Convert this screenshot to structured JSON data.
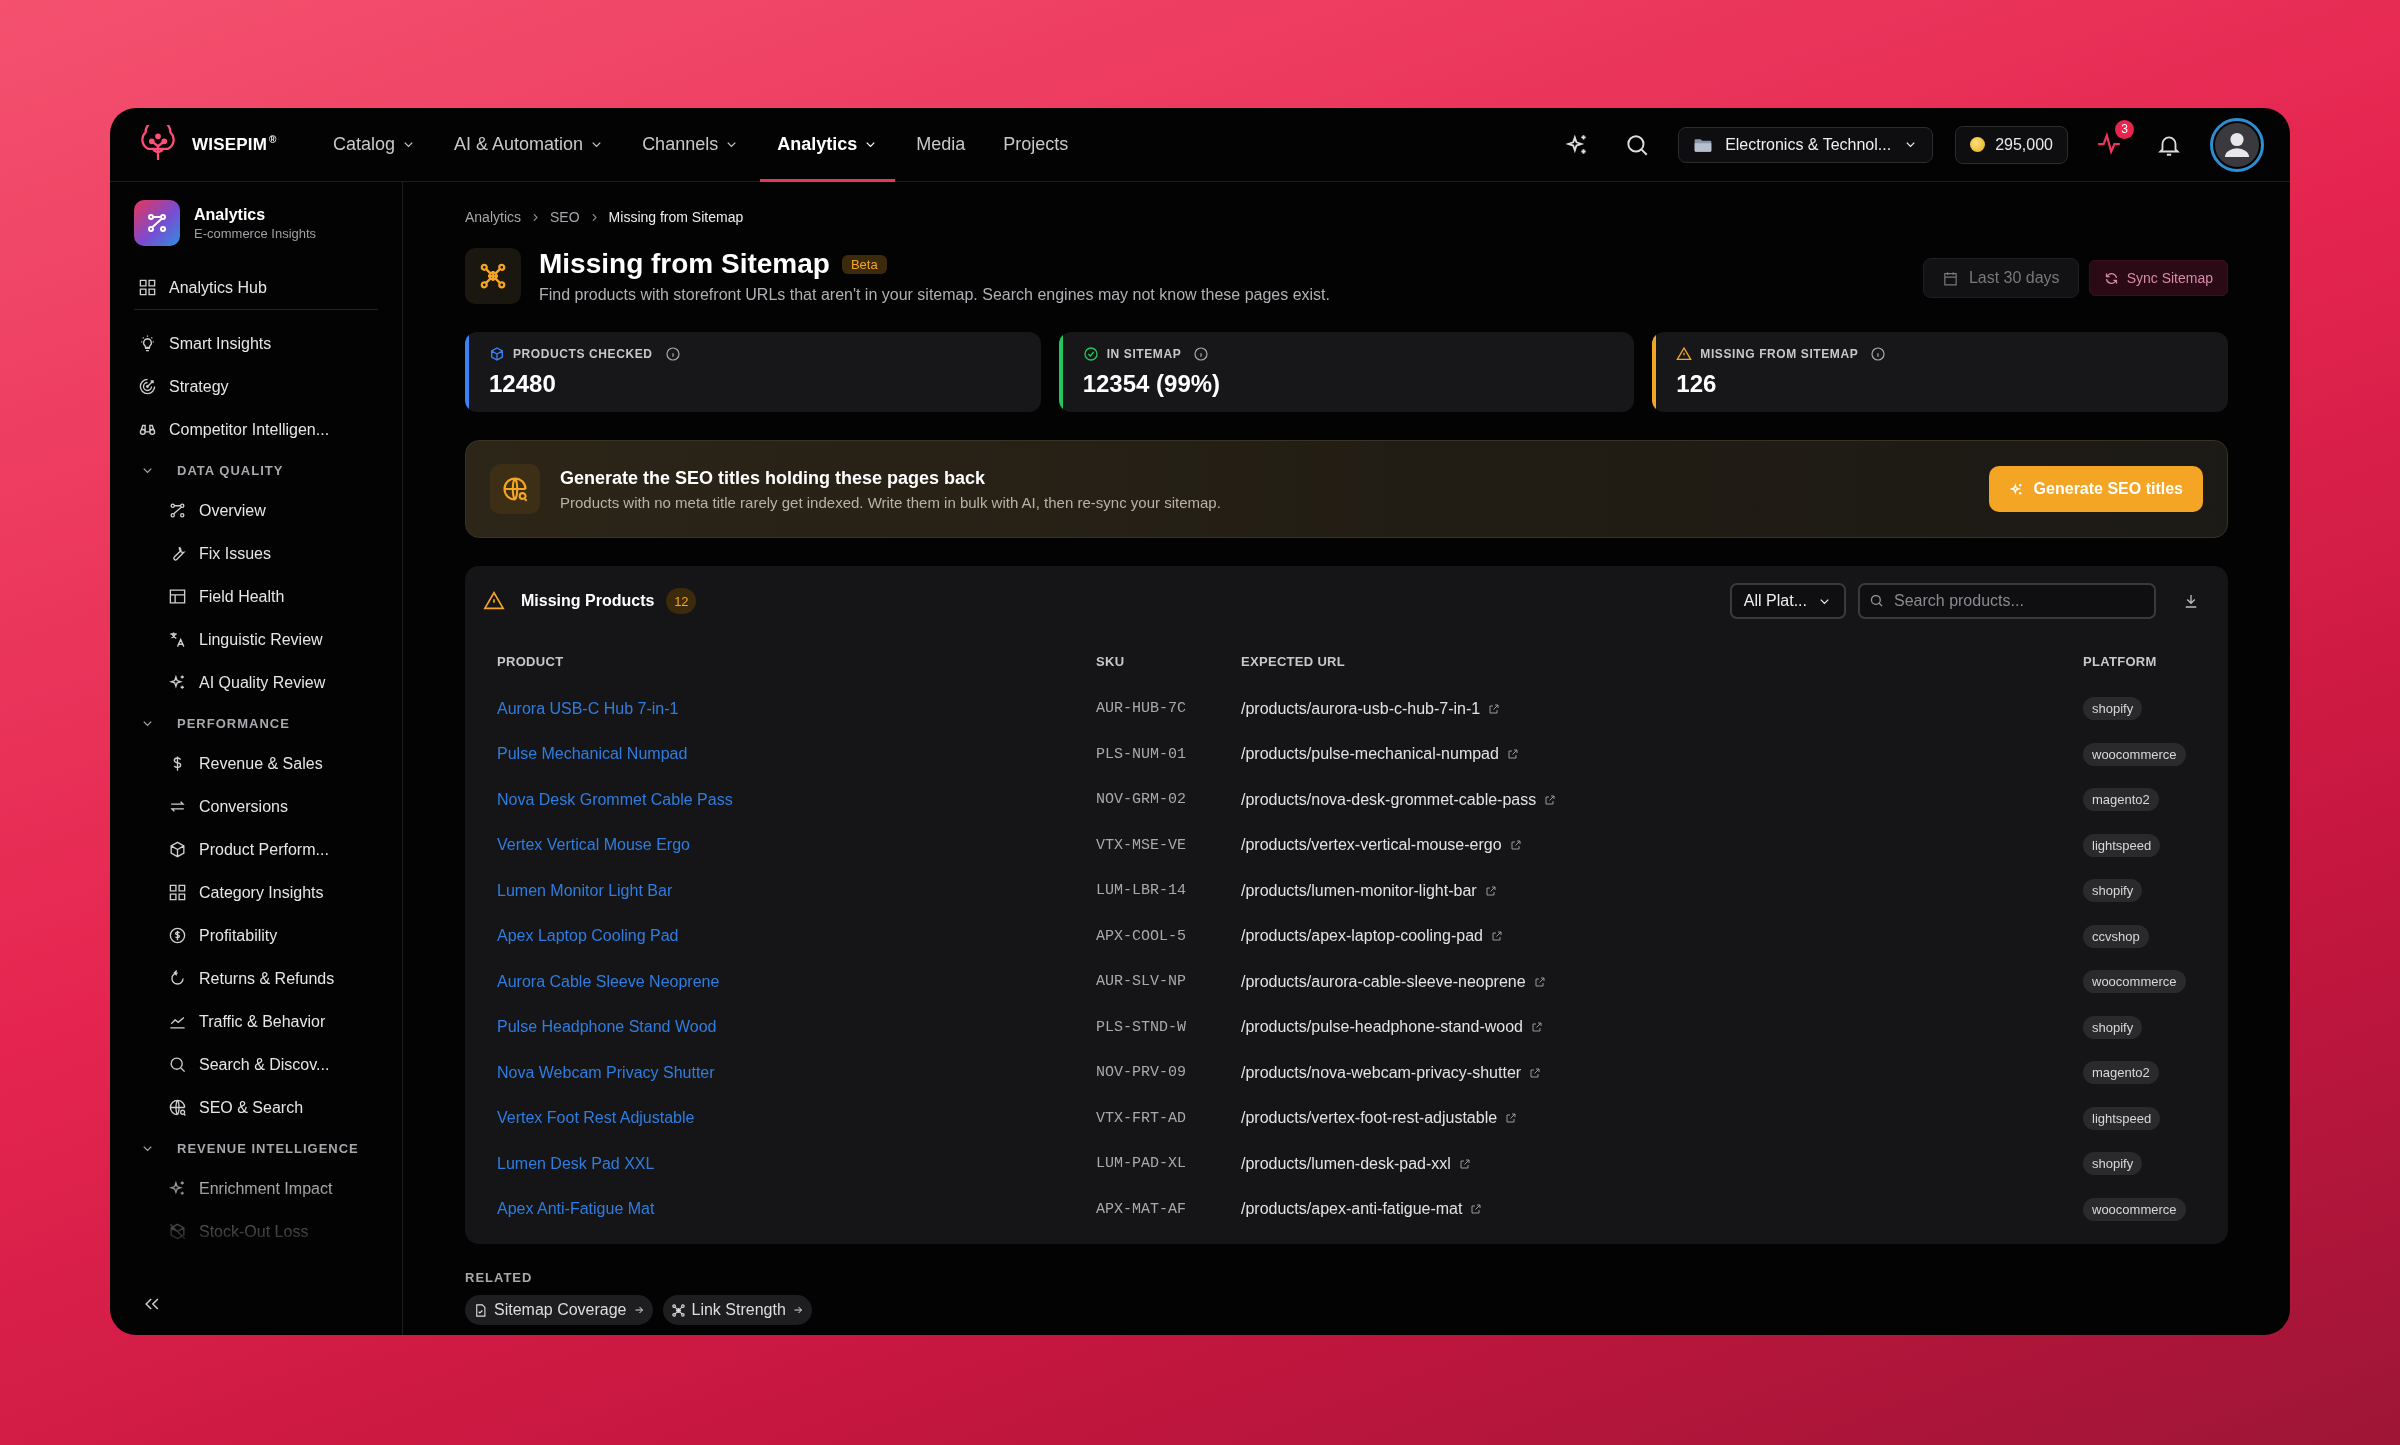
{
  "brand": {
    "name": "WISEPIM",
    "mark": "®"
  },
  "nav": [
    {
      "label": "Catalog",
      "dropdown": true,
      "selected": false
    },
    {
      "label": "AI & Automation",
      "dropdown": true,
      "selected": false
    },
    {
      "label": "Channels",
      "dropdown": true,
      "selected": false
    },
    {
      "label": "Analytics",
      "dropdown": true,
      "selected": true
    },
    {
      "label": "Media",
      "dropdown": false,
      "selected": false
    },
    {
      "label": "Projects",
      "dropdown": false,
      "selected": false
    }
  ],
  "workspace": {
    "label": "Electronics & Technol..."
  },
  "credits": "295,000",
  "alerts_badge": "3",
  "sidebar": {
    "title": "Analytics",
    "subtitle": "E-commerce Insights",
    "pinned": [
      {
        "label": "Analytics Hub"
      }
    ],
    "items": [
      {
        "kind": "link",
        "label": "Smart Insights"
      },
      {
        "kind": "link",
        "label": "Strategy"
      },
      {
        "kind": "link",
        "label": "Competitor Intelligen..."
      },
      {
        "kind": "section",
        "label": "DATA QUALITY",
        "expanded": true,
        "children": [
          {
            "label": "Overview"
          },
          {
            "label": "Fix Issues"
          },
          {
            "label": "Field Health"
          },
          {
            "label": "Linguistic Review"
          },
          {
            "label": "AI Quality Review"
          }
        ]
      },
      {
        "kind": "section",
        "label": "PERFORMANCE",
        "expanded": true,
        "children": [
          {
            "label": "Revenue & Sales"
          },
          {
            "label": "Conversions"
          },
          {
            "label": "Product Perform..."
          },
          {
            "label": "Category Insights"
          },
          {
            "label": "Profitability"
          },
          {
            "label": "Returns & Refunds"
          },
          {
            "label": "Traffic & Behavior"
          },
          {
            "label": "Search & Discov..."
          },
          {
            "label": "SEO & Search"
          }
        ]
      },
      {
        "kind": "section",
        "label": "REVENUE INTELLIGENCE",
        "expanded": true,
        "children": [
          {
            "label": "Enrichment Impact"
          },
          {
            "label": "Stock-Out Loss"
          }
        ]
      }
    ]
  },
  "breadcrumb": [
    "Analytics",
    "SEO",
    "Missing from Sitemap"
  ],
  "page": {
    "title": "Missing from Sitemap",
    "badge": "Beta",
    "subtitle": "Find products with storefront URLs that aren't in your sitemap. Search engines may not know these pages exist."
  },
  "actions": {
    "date_range": "Last 30 days",
    "sync": "Sync Sitemap"
  },
  "stats": [
    {
      "label": "PRODUCTS CHECKED",
      "value": "12480",
      "color": "#3b82f6"
    },
    {
      "label": "IN SITEMAP",
      "value": "12354 (99%)",
      "color": "#22c55e"
    },
    {
      "label": "MISSING FROM SITEMAP",
      "value": "126",
      "color": "#f5a524"
    }
  ],
  "banner": {
    "title": "Generate the SEO titles holding these pages back",
    "text": "Products with no meta title rarely get indexed. Write them in bulk with AI, then re-sync your sitemap.",
    "button": "Generate SEO titles"
  },
  "table": {
    "title": "Missing Products",
    "count": "12",
    "filter": "All Plat...",
    "search_placeholder": "Search products...",
    "columns": [
      "PRODUCT",
      "SKU",
      "EXPECTED URL",
      "PLATFORM"
    ],
    "rows": [
      {
        "product": "Aurora USB-C Hub 7-in-1",
        "sku": "AUR-HUB-7C",
        "url": "/products/aurora-usb-c-hub-7-in-1",
        "platform": "shopify"
      },
      {
        "product": "Pulse Mechanical Numpad",
        "sku": "PLS-NUM-01",
        "url": "/products/pulse-mechanical-numpad",
        "platform": "woocommerce"
      },
      {
        "product": "Nova Desk Grommet Cable Pass",
        "sku": "NOV-GRM-02",
        "url": "/products/nova-desk-grommet-cable-pass",
        "platform": "magento2"
      },
      {
        "product": "Vertex Vertical Mouse Ergo",
        "sku": "VTX-MSE-VE",
        "url": "/products/vertex-vertical-mouse-ergo",
        "platform": "lightspeed"
      },
      {
        "product": "Lumen Monitor Light Bar",
        "sku": "LUM-LBR-14",
        "url": "/products/lumen-monitor-light-bar",
        "platform": "shopify"
      },
      {
        "product": "Apex Laptop Cooling Pad",
        "sku": "APX-COOL-5",
        "url": "/products/apex-laptop-cooling-pad",
        "platform": "ccvshop"
      },
      {
        "product": "Aurora Cable Sleeve Neoprene",
        "sku": "AUR-SLV-NP",
        "url": "/products/aurora-cable-sleeve-neoprene",
        "platform": "woocommerce"
      },
      {
        "product": "Pulse Headphone Stand Wood",
        "sku": "PLS-STND-W",
        "url": "/products/pulse-headphone-stand-wood",
        "platform": "shopify"
      },
      {
        "product": "Nova Webcam Privacy Shutter",
        "sku": "NOV-PRV-09",
        "url": "/products/nova-webcam-privacy-shutter",
        "platform": "magento2"
      },
      {
        "product": "Vertex Foot Rest Adjustable",
        "sku": "VTX-FRT-AD",
        "url": "/products/vertex-foot-rest-adjustable",
        "platform": "lightspeed"
      },
      {
        "product": "Lumen Desk Pad XXL",
        "sku": "LUM-PAD-XL",
        "url": "/products/lumen-desk-pad-xxl",
        "platform": "shopify"
      },
      {
        "product": "Apex Anti-Fatigue Mat",
        "sku": "APX-MAT-AF",
        "url": "/products/apex-anti-fatigue-mat",
        "platform": "woocommerce"
      }
    ]
  },
  "related": {
    "label": "RELATED",
    "links": [
      {
        "label": "Sitemap Coverage"
      },
      {
        "label": "Link Strength"
      }
    ]
  }
}
